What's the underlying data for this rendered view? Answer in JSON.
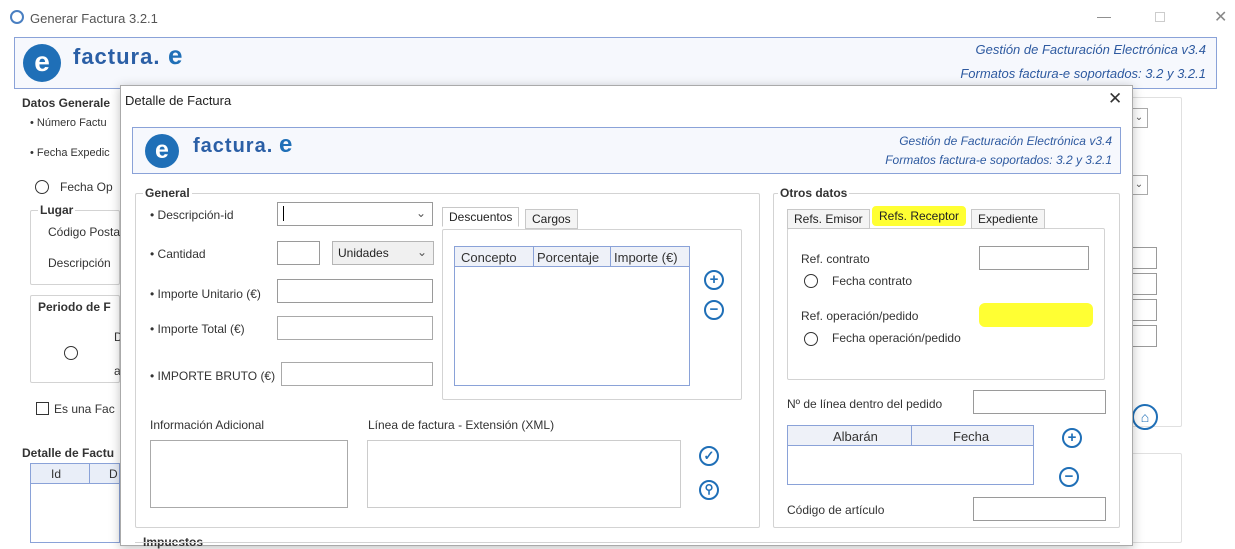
{
  "outer": {
    "title": "Generar Factura 3.2.1",
    "header": {
      "line1": "Gestión de Facturación Electrónica v3.4",
      "line2": "Formatos factura-e soportados: 3.2 y 3.2.1"
    },
    "datos_generales": "Datos Generale",
    "numero_factura": "• Número Factu",
    "fecha_expedicion": "• Fecha Expedic",
    "fecha_op": "Fecha Op",
    "lugar": "Lugar",
    "codigo_postal": "Código Posta",
    "descripcion": "Descripción",
    "periodo": "Periodo de F",
    "periodo_d": "D",
    "periodo_a": "a",
    "es_una_fac": "Es una Fac",
    "detalle_factura": "Detalle de Factu",
    "col_id": "Id",
    "col_d": "D"
  },
  "logo": {
    "text": "factura.",
    "e": "e"
  },
  "dialog": {
    "title": "Detalle de Factura",
    "header": {
      "line1": "Gestión de Facturación Electrónica v3.4",
      "line2": "Formatos factura-e soportados: 3.2 y 3.2.1"
    },
    "general": {
      "title": "General",
      "descripcion_id": "• Descripción-id",
      "cantidad": "• Cantidad",
      "unidades": "Unidades",
      "importe_unitario": "• Importe Unitario (€)",
      "importe_total": "• Importe Total (€)",
      "importe_bruto": "• IMPORTE BRUTO (€)"
    },
    "tabs_desc": [
      "Descuentos",
      "Cargos"
    ],
    "desc_columns": [
      "Concepto",
      "Porcentaje",
      "Importe (€)"
    ],
    "info_adicional": "Información Adicional",
    "linea_ext": "Línea de factura - Extensión (XML)",
    "impuestos": "Impuestos",
    "otros": {
      "title": "Otros datos",
      "tabs": [
        "Refs. Emisor",
        "Refs. Receptor",
        "Expediente"
      ],
      "ref_contrato": "Ref. contrato",
      "fecha_contrato": "Fecha contrato",
      "ref_operacion": "Ref. operación/pedido",
      "fecha_operacion": "Fecha operación/pedido",
      "linea_pedido": "Nº de línea dentro del pedido",
      "albaran_cols": [
        "Albarán",
        "Fecha"
      ],
      "codigo_articulo": "Código de artículo"
    }
  },
  "colors": {
    "accent": "#1f6fb7",
    "highlight": "#ffff33",
    "header_bg": "#eef2fb"
  }
}
